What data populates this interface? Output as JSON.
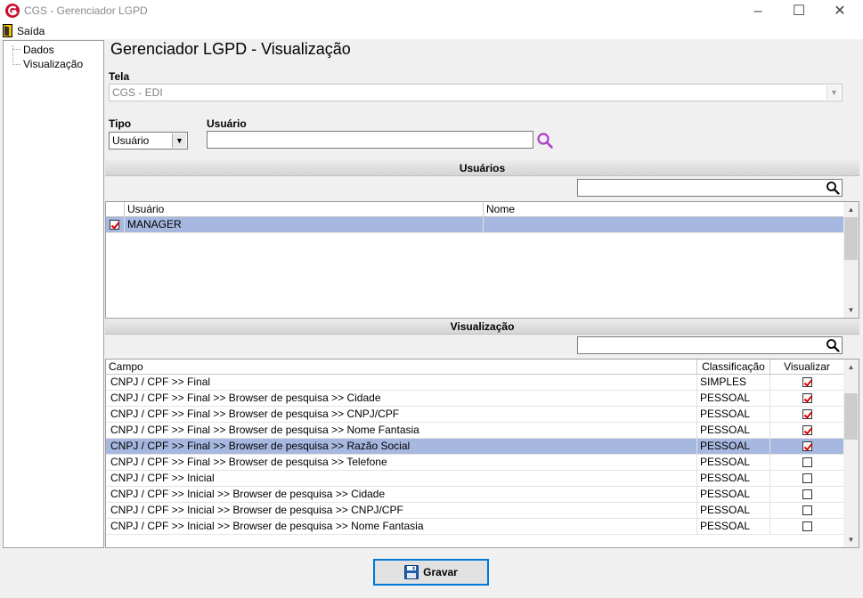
{
  "window": {
    "title": "CGS - Gerenciador LGPD"
  },
  "menu": {
    "exit_label": "Saída"
  },
  "tree": {
    "items": [
      "Dados",
      "Visualização"
    ]
  },
  "page": {
    "title": "Gerenciador LGPD - Visualização"
  },
  "form": {
    "tela_label": "Tela",
    "tela_value": "CGS - EDI",
    "tipo_label": "Tipo",
    "tipo_value": "Usuário",
    "usuario_label": "Usuário",
    "usuario_value": ""
  },
  "usuarios": {
    "header": "Usuários",
    "filter_value": "",
    "columns": [
      "Usuário",
      "Nome"
    ],
    "rows": [
      {
        "checked": true,
        "usuario": "MANAGER",
        "nome": "",
        "selected": true
      }
    ]
  },
  "visualizacao": {
    "header": "Visualização",
    "filter_value": "",
    "columns": [
      "Campo",
      "Classificação",
      "Visualizar"
    ],
    "rows": [
      {
        "campo": "CNPJ / CPF >> Final",
        "classificacao": "SIMPLES",
        "visualizar": true,
        "selected": false
      },
      {
        "campo": "CNPJ / CPF >> Final >> Browser de pesquisa >> Cidade",
        "classificacao": "PESSOAL",
        "visualizar": true,
        "selected": false
      },
      {
        "campo": "CNPJ / CPF >> Final >> Browser de pesquisa >> CNPJ/CPF",
        "classificacao": "PESSOAL",
        "visualizar": true,
        "selected": false
      },
      {
        "campo": "CNPJ / CPF >> Final >> Browser de pesquisa >> Nome Fantasia",
        "classificacao": "PESSOAL",
        "visualizar": true,
        "selected": false
      },
      {
        "campo": "CNPJ / CPF >> Final >> Browser de pesquisa >> Razão Social",
        "classificacao": "PESSOAL",
        "visualizar": true,
        "selected": true
      },
      {
        "campo": "CNPJ / CPF >> Final >> Browser de pesquisa >> Telefone",
        "classificacao": "PESSOAL",
        "visualizar": false,
        "selected": false
      },
      {
        "campo": "CNPJ / CPF >> Inicial",
        "classificacao": "PESSOAL",
        "visualizar": false,
        "selected": false
      },
      {
        "campo": "CNPJ / CPF >> Inicial >> Browser de pesquisa >> Cidade",
        "classificacao": "PESSOAL",
        "visualizar": false,
        "selected": false
      },
      {
        "campo": "CNPJ / CPF >> Inicial >> Browser de pesquisa >> CNPJ/CPF",
        "classificacao": "PESSOAL",
        "visualizar": false,
        "selected": false
      },
      {
        "campo": "CNPJ / CPF >> Inicial >> Browser de pesquisa >> Nome Fantasia",
        "classificacao": "PESSOAL",
        "visualizar": false,
        "selected": false
      }
    ]
  },
  "actions": {
    "save_label": "Gravar"
  },
  "icons": {
    "app": "app-logo-icon",
    "exit": "exit-door-icon",
    "search": "search-icon",
    "save": "floppy-disk-icon"
  },
  "colors": {
    "accent": "#0078d7",
    "selection": "#a6b8e0",
    "check": "#dd0000",
    "search_purple": "#b03cc8"
  }
}
